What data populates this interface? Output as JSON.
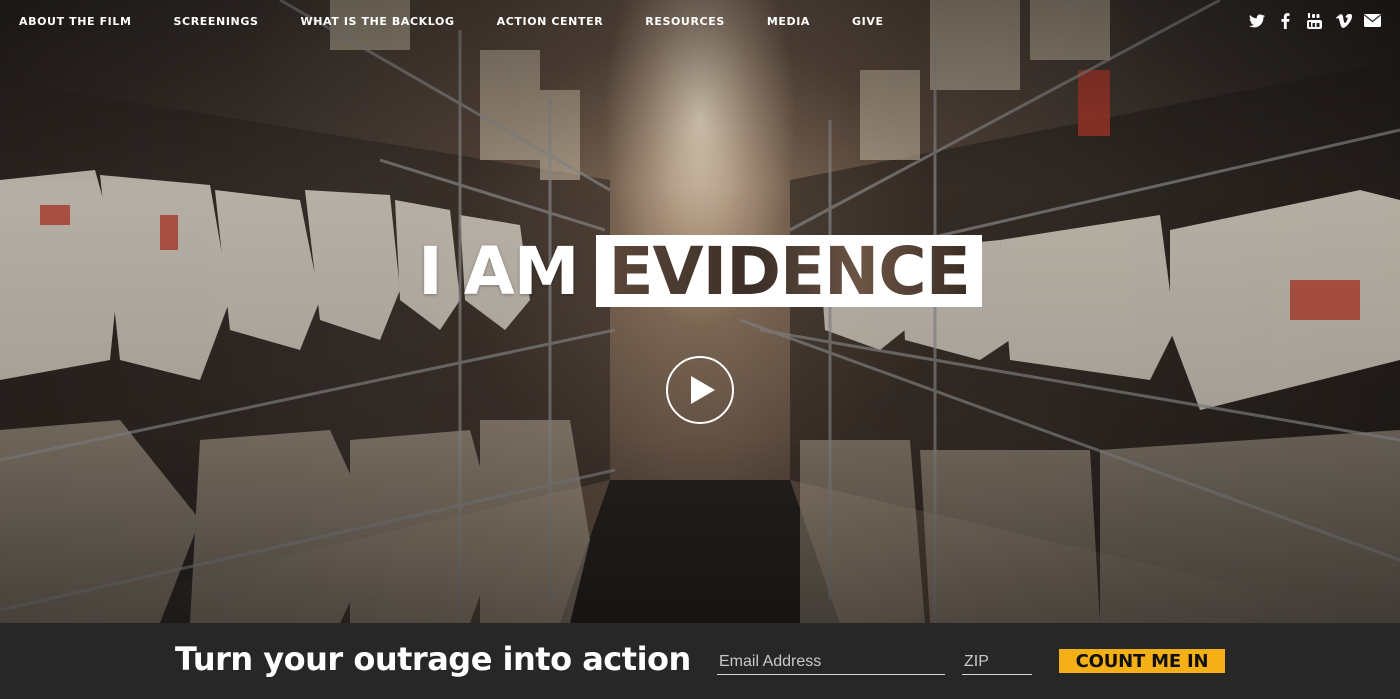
{
  "nav": {
    "items": [
      {
        "label": "ABOUT THE FILM"
      },
      {
        "label": "SCREENINGS"
      },
      {
        "label": "WHAT IS THE BACKLOG"
      },
      {
        "label": "ACTION CENTER"
      },
      {
        "label": "RESOURCES"
      },
      {
        "label": "MEDIA"
      },
      {
        "label": "GIVE"
      }
    ],
    "social_icons": [
      "twitter-icon",
      "facebook-icon",
      "youtube-icon",
      "vimeo-icon",
      "email-icon"
    ]
  },
  "hero": {
    "title_plain": "I AM",
    "title_boxed": "EVIDENCE",
    "play_icon": "play-icon"
  },
  "signup": {
    "headline": "Turn your outrage into action",
    "email_placeholder": "Email Address",
    "zip_placeholder": "ZIP",
    "button_label": "COUNT ME IN"
  },
  "colors": {
    "accent": "#f5b017",
    "bar_bg": "#272727",
    "text": "#ffffff"
  }
}
